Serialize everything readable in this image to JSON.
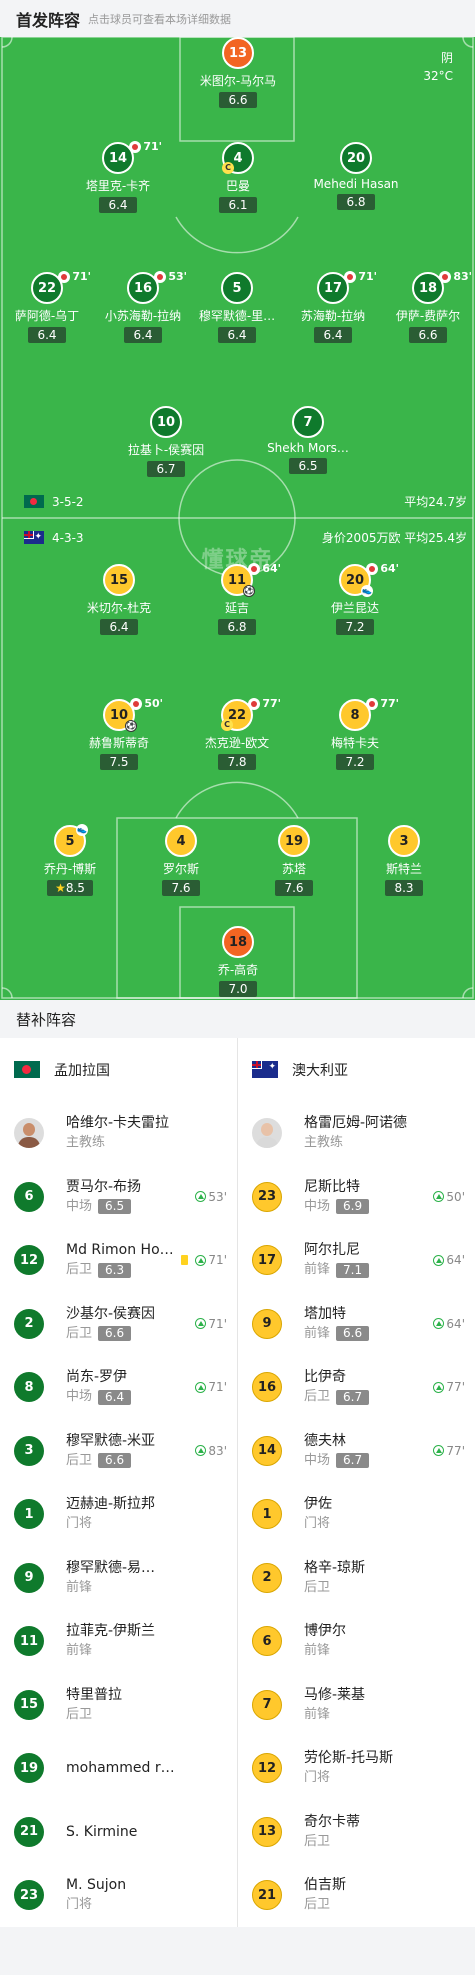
{
  "header": {
    "title": "首发阵容",
    "subtitle": "点击球员可查看本场详细数据"
  },
  "weather": {
    "condition": "阴",
    "temp": "32°C"
  },
  "watermark": "懂球帝",
  "bangladesh": {
    "formation": "3-5-2",
    "info": "平均24.7岁",
    "players": [
      {
        "num": "13",
        "name": "米图尔-马尔马",
        "rating": "6.6"
      },
      {
        "num": "14",
        "name": "塔里克-卡齐",
        "rating": "6.4",
        "subMin": "71'"
      },
      {
        "num": "4",
        "name": "巴曼",
        "rating": "6.1",
        "captain": "C"
      },
      {
        "num": "20",
        "name": "Mehedi Hasan",
        "rating": "6.8"
      },
      {
        "num": "22",
        "name": "萨阿德-乌丁",
        "rating": "6.4",
        "subMin": "71'"
      },
      {
        "num": "16",
        "name": "小苏海勒-拉纳",
        "rating": "6.4",
        "subMin": "53'"
      },
      {
        "num": "5",
        "name": "穆罕默德-里…",
        "rating": "6.4"
      },
      {
        "num": "17",
        "name": "苏海勒-拉纳",
        "rating": "6.4",
        "subMin": "71'"
      },
      {
        "num": "18",
        "name": "伊萨-费萨尔",
        "rating": "6.6",
        "subMin": "83'"
      },
      {
        "num": "10",
        "name": "拉基卜-侯赛因",
        "rating": "6.7"
      },
      {
        "num": "7",
        "name": "Shekh Mors…",
        "rating": "6.5"
      }
    ]
  },
  "australia": {
    "formation": "4-3-3",
    "info": "身价2005万欧 平均25.4岁",
    "players": [
      {
        "num": "15",
        "name": "米切尔-杜克",
        "rating": "6.4"
      },
      {
        "num": "11",
        "name": "延吉",
        "rating": "6.8",
        "subMin": "64'"
      },
      {
        "num": "20",
        "name": "伊兰昆达",
        "rating": "7.2",
        "subMin": "64'"
      },
      {
        "num": "10",
        "name": "赫鲁斯蒂奇",
        "rating": "7.5",
        "subMin": "50'"
      },
      {
        "num": "22",
        "name": "杰克逊-欧文",
        "rating": "7.8",
        "subMin": "77'",
        "captain": "C"
      },
      {
        "num": "8",
        "name": "梅特卡夫",
        "rating": "7.2",
        "subMin": "77'"
      },
      {
        "num": "5",
        "name": "乔丹-博斯",
        "rating": "8.5"
      },
      {
        "num": "4",
        "name": "罗尔斯",
        "rating": "7.6"
      },
      {
        "num": "19",
        "name": "苏塔",
        "rating": "7.6"
      },
      {
        "num": "3",
        "name": "斯特兰",
        "rating": "8.3"
      },
      {
        "num": "18",
        "name": "乔-高奇",
        "rating": "7.0"
      }
    ]
  },
  "bench": {
    "title": "替补阵容",
    "left": {
      "team": "孟加拉国",
      "coach": {
        "name": "哈维尔-卡夫雷拉",
        "role": "主教练"
      },
      "subs": [
        {
          "num": "6",
          "name": "贾马尔-布扬",
          "pos": "中场",
          "rating": "6.5",
          "min": "53'"
        },
        {
          "num": "12",
          "name": "Md Rimon Ho…",
          "pos": "后卫",
          "rating": "6.3",
          "min": "71'",
          "yellow": true
        },
        {
          "num": "2",
          "name": "沙基尔-侯赛因",
          "pos": "后卫",
          "rating": "6.6",
          "min": "71'"
        },
        {
          "num": "8",
          "name": "尚东-罗伊",
          "pos": "中场",
          "rating": "6.4",
          "min": "71'"
        },
        {
          "num": "3",
          "name": "穆罕默德-米亚",
          "pos": "后卫",
          "rating": "6.6",
          "min": "83'"
        },
        {
          "num": "1",
          "name": "迈赫迪-斯拉邦",
          "pos": "门将"
        },
        {
          "num": "9",
          "name": "穆罕默德-易…",
          "pos": "前锋"
        },
        {
          "num": "11",
          "name": "拉菲克-伊斯兰",
          "pos": "前锋"
        },
        {
          "num": "15",
          "name": "特里普拉",
          "pos": "后卫"
        },
        {
          "num": "19",
          "name": "mohammed r…",
          "pos": ""
        },
        {
          "num": "21",
          "name": "S. Kirmine",
          "pos": ""
        },
        {
          "num": "23",
          "name": "M. Sujon",
          "pos": "门将"
        }
      ]
    },
    "right": {
      "team": "澳大利亚",
      "coach": {
        "name": "格雷厄姆-阿诺德",
        "role": "主教练"
      },
      "subs": [
        {
          "num": "23",
          "name": "尼斯比特",
          "pos": "中场",
          "rating": "6.9",
          "min": "50'"
        },
        {
          "num": "17",
          "name": "阿尔扎尼",
          "pos": "前锋",
          "rating": "7.1",
          "min": "64'"
        },
        {
          "num": "9",
          "name": "塔加特",
          "pos": "前锋",
          "rating": "6.6",
          "min": "64'"
        },
        {
          "num": "16",
          "name": "比伊奇",
          "pos": "后卫",
          "rating": "6.7",
          "min": "77'"
        },
        {
          "num": "14",
          "name": "德夫林",
          "pos": "中场",
          "rating": "6.7",
          "min": "77'"
        },
        {
          "num": "1",
          "name": "伊佐",
          "pos": "门将"
        },
        {
          "num": "2",
          "name": "格辛-琼斯",
          "pos": "后卫"
        },
        {
          "num": "6",
          "name": "博伊尔",
          "pos": "前锋"
        },
        {
          "num": "7",
          "name": "马修-莱基",
          "pos": "前锋"
        },
        {
          "num": "12",
          "name": "劳伦斯-托马斯",
          "pos": "门将"
        },
        {
          "num": "13",
          "name": "奇尔卡蒂",
          "pos": "后卫"
        },
        {
          "num": "21",
          "name": "伯吉斯",
          "pos": "后卫"
        }
      ]
    }
  }
}
